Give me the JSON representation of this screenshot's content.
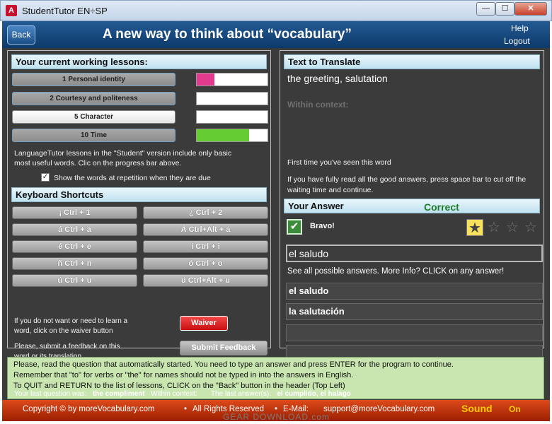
{
  "window": {
    "title": "StudentTutor EN÷SP",
    "icon_text": "A",
    "minimize": "—",
    "maximize": "☐",
    "close": "✕"
  },
  "header": {
    "back_label": "Back",
    "title": "A new way to think about “vocabulary”",
    "help_label": "Help",
    "logout_label": "Logout"
  },
  "left_panel": {
    "lessons_title": "Your current working lessons:",
    "lessons": [
      {
        "label": "1 Personal identity",
        "progress_pct": 25,
        "color": "#e23a8d"
      },
      {
        "label": "2 Courtesy and politeness",
        "progress_pct": 0,
        "color": "#ffffff"
      },
      {
        "label": "5 Character",
        "progress_pct": 0,
        "color": "#ffffff"
      },
      {
        "label": "10 Time",
        "progress_pct": 74,
        "color": "#66cc33"
      }
    ],
    "lessons_info": "LanguageTutor lessons in the \"Student\" version include only basic most useful words. Clic on the progress bar above.",
    "show_repetition_label": "Show the words at repetition when they are due",
    "show_repetition_checked": true,
    "check_glyph": "✓",
    "shortcuts_title": "Keyboard Shortcuts",
    "shortcuts": [
      "¡  Ctrl + 1",
      "¿  Ctrl + 2",
      "á  Ctrl + a",
      "Á  Ctrl+Alt + a",
      "é  Ctrl + e",
      "í  Ctrl + i",
      "ñ  Ctrl + n",
      "ó  Ctrl + o",
      "ú  Ctrl + u",
      "ü  Ctrl+Alt + u"
    ],
    "waiver_info": "If you do not want or need to learn a word, click on the waiver button",
    "waiver_label": "Waiver",
    "feedback_info": "Please, submit a feedback on this word or its translation",
    "feedback_label": "Submit Feedback"
  },
  "right_panel": {
    "translate_title": "Text to Translate",
    "question": "the greeting, salutation",
    "context_label": "Within context:",
    "first_time": "First time you've seen this word",
    "space_hint": "If you have fully read all the good answers, press space bar to cut off the waiting time and continue.",
    "answer_title": "Your Answer",
    "result": "Correct",
    "bravo": "Bravo!",
    "check_glyph": "✔",
    "stars_filled": 1,
    "stars_total": 4,
    "star_glyph": "★",
    "star_empty_glyph": "☆",
    "answer_value": "el saludo",
    "see_all": "See all possible answers. More Info? CLICK on any answer!",
    "answers": [
      "el saludo",
      "la salutación",
      "",
      ""
    ]
  },
  "instructions": {
    "line1": "Please, read the question that automatically started. You need to type an answer and press ENTER for the program to continue.",
    "line2": "Remember that \"to\" for verbs or \"the\" for names should not be typed in into the answers in English.",
    "line3": "To QUIT and RETURN to the list of lessons, CLICK on the \"Back\" button in the header (Top Left)"
  },
  "last_question": {
    "label": "Your last question was:",
    "value": "the compliment",
    "context_label": "Within context:",
    "answers_label": "The last answer(s):",
    "answers_value": "el cumplido, el halago"
  },
  "footer": {
    "copyright": "Copyright © by moreVocabulary.com",
    "rights": "All Rights Reserved",
    "email_label": "E-Mail:",
    "email": "support@moreVocabulary.com",
    "separator": "•",
    "sound_label": "Sound",
    "sound_state": "On"
  },
  "watermark": "GEAR DOWNLOAD.com"
}
